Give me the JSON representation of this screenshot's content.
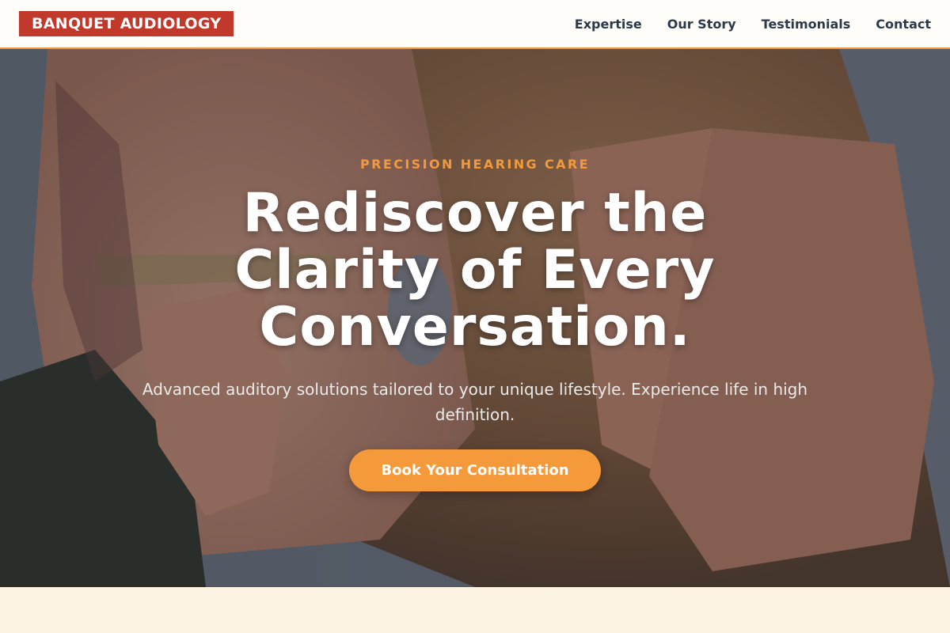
{
  "header": {
    "logo_text": "BANQUET AUDIOLOGY",
    "nav": [
      {
        "label": "Expertise"
      },
      {
        "label": "Our Story"
      },
      {
        "label": "Testimonials"
      },
      {
        "label": "Contact"
      }
    ]
  },
  "hero": {
    "eyebrow": "PRECISION HEARING CARE",
    "headline": "Rediscover the Clarity of Every Conversation.",
    "subtext": "Advanced auditory solutions tailored to your unique lifestyle. Experience life in high definition.",
    "cta_label": "Book Your Consultation",
    "image_subject": "woman fitting a hearing aid behind her ear"
  },
  "colors": {
    "accent": "#f59a3a",
    "brand": "#c0392b",
    "nav_text": "#2c3a47",
    "page_background": "#fdf3e3"
  }
}
